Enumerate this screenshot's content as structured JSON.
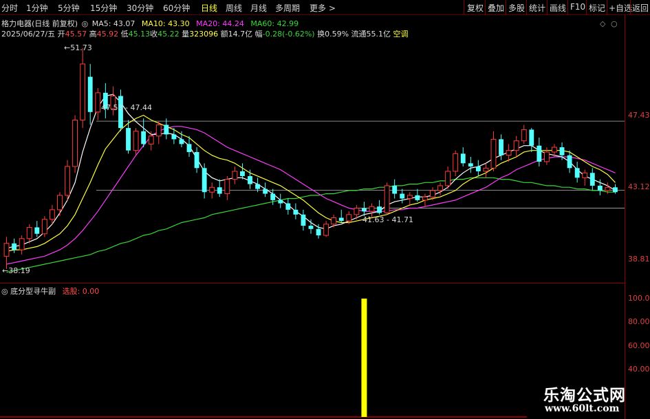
{
  "toolbar": {
    "timeframes": [
      {
        "label": "分时",
        "active": false
      },
      {
        "label": "1分钟",
        "active": false
      },
      {
        "label": "5分钟",
        "active": false
      },
      {
        "label": "15分钟",
        "active": false
      },
      {
        "label": "30分钟",
        "active": false
      },
      {
        "label": "60分钟",
        "active": false
      },
      {
        "label": "日线",
        "active": true
      },
      {
        "label": "周线",
        "active": false
      },
      {
        "label": "月线",
        "active": false
      },
      {
        "label": "多周期",
        "active": false
      },
      {
        "label": "更多 >",
        "active": false
      }
    ],
    "right_buttons": [
      "复权",
      "叠加",
      "多股",
      "统计",
      "画线",
      "F10",
      "标记",
      "+自选",
      "返回"
    ]
  },
  "header": {
    "stock_title": "格力电器(日线 前复权)",
    "ma5": "MA5: 43.07",
    "ma10": "MA10: 43.30",
    "ma20": "MA20: 44.24",
    "ma60": "MA60: 42.99",
    "icons": [
      "◇",
      "○"
    ]
  },
  "quote": {
    "date": "2025/06/27/五",
    "open_label": "开",
    "open": "45.57",
    "high_label": "高",
    "high": "45.92",
    "low_label": "低",
    "low": "45.13",
    "close_label": "收",
    "close": "45.22",
    "vol_label": "量",
    "vol": "323096",
    "amt_label": "额",
    "amt": "14.7亿",
    "chg_label": "幅",
    "chg": "-0.28(-0.62%)",
    "turn_label": "换",
    "turn": "0.59%",
    "float_label": "流通",
    "float": "55.1亿",
    "status": "空调"
  },
  "annotations": {
    "peak": "51.73",
    "low": "38.19",
    "range1": "47.53 - 47.44",
    "range2": "41.63 - 41.71"
  },
  "price_axis": [
    "47.43",
    "43.12",
    "38.81"
  ],
  "indicator": {
    "name": "底分型寻牛副",
    "series_label": "选股: 0.00",
    "axis": [
      "100.0",
      "80.00",
      "60.00",
      "40.00"
    ]
  },
  "watermark": {
    "name": "乐淘公式网",
    "url": "www.60lt.com"
  },
  "chart_data": {
    "type": "candlestick",
    "price_range": [
      37.9,
      52.5
    ],
    "levels": [
      47.43,
      43.12,
      42.0
    ],
    "candles": [
      [
        39.0,
        40.2,
        38.2,
        39.8
      ],
      [
        39.8,
        40.1,
        39.2,
        39.4
      ],
      [
        39.4,
        40.3,
        39.1,
        40.1
      ],
      [
        40.1,
        41.0,
        39.8,
        40.8
      ],
      [
        40.8,
        41.2,
        40.2,
        40.4
      ],
      [
        40.4,
        41.5,
        40.2,
        41.3
      ],
      [
        41.3,
        42.2,
        41.0,
        41.9
      ],
      [
        41.9,
        43.0,
        41.5,
        42.8
      ],
      [
        42.8,
        45.0,
        42.5,
        44.6
      ],
      [
        44.6,
        47.8,
        44.2,
        47.5
      ],
      [
        47.5,
        52.0,
        47.0,
        51.0
      ],
      [
        50.2,
        51.0,
        47.2,
        48.0
      ],
      [
        48.0,
        49.5,
        47.5,
        49.2
      ],
      [
        49.2,
        49.8,
        47.6,
        48.2
      ],
      [
        48.2,
        49.6,
        47.8,
        49.0
      ],
      [
        49.0,
        49.4,
        46.8,
        47.0
      ],
      [
        47.0,
        47.5,
        45.4,
        45.6
      ],
      [
        45.6,
        47.0,
        45.3,
        46.8
      ],
      [
        46.8,
        47.6,
        45.8,
        46.0
      ],
      [
        46.0,
        46.8,
        45.6,
        46.5
      ],
      [
        46.5,
        47.4,
        46.0,
        47.2
      ],
      [
        47.2,
        47.6,
        46.3,
        46.6
      ],
      [
        46.6,
        47.0,
        46.0,
        46.3
      ],
      [
        46.3,
        46.8,
        45.8,
        46.0
      ],
      [
        46.0,
        46.5,
        45.2,
        45.5
      ],
      [
        45.5,
        45.8,
        44.2,
        44.5
      ],
      [
        44.5,
        44.8,
        42.6,
        43.0
      ],
      [
        43.0,
        43.6,
        42.6,
        43.3
      ],
      [
        43.3,
        43.8,
        42.7,
        42.9
      ],
      [
        42.9,
        44.0,
        42.5,
        43.8
      ],
      [
        43.8,
        44.6,
        43.5,
        44.3
      ],
      [
        44.3,
        44.8,
        43.8,
        44.0
      ],
      [
        44.0,
        44.4,
        43.2,
        43.5
      ],
      [
        43.5,
        43.9,
        43.0,
        43.2
      ],
      [
        43.2,
        43.6,
        42.7,
        42.9
      ],
      [
        42.9,
        43.2,
        42.2,
        42.5
      ],
      [
        42.5,
        42.9,
        42.0,
        42.3
      ],
      [
        42.3,
        42.6,
        41.6,
        41.9
      ],
      [
        41.9,
        42.3,
        41.3,
        41.6
      ],
      [
        41.6,
        41.9,
        40.6,
        40.9
      ],
      [
        40.9,
        41.3,
        40.4,
        40.7
      ],
      [
        40.7,
        41.0,
        40.1,
        40.3
      ],
      [
        40.3,
        41.2,
        40.2,
        41.0
      ],
      [
        41.0,
        41.6,
        40.8,
        41.4
      ],
      [
        41.4,
        41.9,
        41.1,
        41.2
      ],
      [
        41.2,
        41.8,
        41.0,
        41.6
      ],
      [
        41.6,
        42.2,
        41.3,
        42.0
      ],
      [
        42.0,
        42.4,
        41.5,
        41.8
      ],
      [
        41.8,
        42.3,
        41.4,
        42.1
      ],
      [
        42.1,
        42.5,
        41.6,
        41.7
      ],
      [
        41.7,
        43.6,
        41.6,
        43.4
      ],
      [
        43.4,
        43.8,
        42.6,
        42.9
      ],
      [
        42.9,
        43.2,
        42.3,
        42.6
      ],
      [
        42.6,
        43.0,
        42.2,
        42.8
      ],
      [
        42.8,
        43.2,
        42.4,
        42.5
      ],
      [
        42.5,
        42.9,
        42.1,
        42.7
      ],
      [
        42.7,
        43.3,
        42.5,
        43.1
      ],
      [
        43.1,
        43.6,
        42.8,
        43.4
      ],
      [
        43.4,
        44.6,
        43.2,
        44.3
      ],
      [
        44.3,
        45.6,
        44.0,
        45.4
      ],
      [
        45.4,
        45.8,
        44.6,
        44.8
      ],
      [
        44.8,
        45.2,
        44.2,
        44.6
      ],
      [
        44.6,
        45.0,
        44.0,
        44.3
      ],
      [
        44.3,
        44.8,
        43.9,
        44.5
      ],
      [
        44.5,
        46.8,
        44.3,
        46.3
      ],
      [
        46.3,
        46.6,
        45.0,
        45.3
      ],
      [
        45.3,
        46.0,
        44.9,
        45.6
      ],
      [
        45.6,
        46.5,
        45.2,
        46.2
      ],
      [
        46.2,
        47.2,
        46.0,
        46.9
      ],
      [
        46.9,
        47.0,
        45.5,
        45.9
      ],
      [
        45.9,
        46.4,
        44.6,
        44.9
      ],
      [
        44.9,
        45.8,
        44.7,
        45.5
      ],
      [
        45.5,
        46.0,
        45.2,
        45.8
      ],
      [
        45.8,
        46.1,
        45.0,
        45.3
      ],
      [
        45.3,
        45.6,
        44.2,
        44.5
      ],
      [
        44.5,
        44.9,
        43.6,
        43.9
      ],
      [
        43.9,
        44.4,
        43.4,
        44.2
      ],
      [
        44.2,
        44.5,
        43.1,
        43.4
      ],
      [
        43.4,
        43.8,
        42.8,
        43.1
      ],
      [
        43.1,
        43.6,
        42.9,
        43.3
      ],
      [
        43.3,
        43.5,
        42.9,
        43.0
      ]
    ],
    "ma5": [
      39.5,
      39.6,
      39.7,
      39.9,
      40.1,
      40.5,
      41.0,
      41.7,
      42.5,
      43.6,
      45.5,
      47.0,
      48.3,
      49.0,
      49.1,
      48.6,
      47.9,
      47.4,
      47.0,
      46.6,
      46.6,
      46.7,
      46.6,
      46.3,
      45.9,
      45.1,
      44.3,
      43.9,
      43.7,
      43.8,
      43.9,
      43.9,
      43.7,
      43.5,
      43.2,
      42.9,
      42.5,
      42.2,
      41.8,
      41.5,
      41.1,
      40.8,
      40.7,
      40.9,
      41.0,
      41.2,
      41.4,
      41.6,
      41.7,
      41.8,
      42.2,
      42.4,
      42.5,
      42.6,
      42.7,
      42.7,
      42.8,
      43.0,
      43.3,
      43.8,
      44.2,
      44.5,
      44.6,
      44.8,
      45.1,
      45.3,
      45.5,
      45.7,
      45.9,
      45.9,
      45.6,
      45.4,
      45.3,
      45.2,
      44.9,
      44.4,
      44.0,
      43.8,
      43.6,
      43.4,
      43.1
    ],
    "ma10": [
      39.3,
      39.4,
      39.4,
      39.5,
      39.6,
      39.8,
      40.1,
      40.4,
      40.9,
      41.6,
      42.6,
      43.6,
      44.7,
      45.7,
      46.3,
      46.9,
      47.3,
      47.6,
      47.8,
      47.5,
      47.3,
      47.1,
      46.9,
      46.6,
      46.4,
      46.0,
      45.6,
      45.3,
      45.1,
      45.0,
      44.8,
      44.5,
      44.2,
      44.0,
      43.8,
      43.6,
      43.4,
      43.1,
      42.8,
      42.5,
      42.1,
      41.7,
      41.4,
      41.2,
      41.1,
      41.1,
      41.2,
      41.3,
      41.4,
      41.5,
      41.6,
      41.8,
      42.0,
      42.2,
      42.3,
      42.5,
      42.6,
      42.7,
      42.9,
      43.1,
      43.5,
      43.8,
      44.0,
      44.2,
      44.5,
      44.8,
      45.0,
      45.2,
      45.5,
      45.6,
      45.6,
      45.6,
      45.6,
      45.6,
      45.5,
      45.2,
      44.9,
      44.6,
      44.4,
      44.1,
      43.6
    ],
    "ma20": [
      38.5,
      38.6,
      38.7,
      38.8,
      38.9,
      39.0,
      39.2,
      39.4,
      39.7,
      40.1,
      40.6,
      41.2,
      41.8,
      42.5,
      43.2,
      43.9,
      44.6,
      45.3,
      45.9,
      46.5,
      46.8,
      47.0,
      47.1,
      47.1,
      47.0,
      46.9,
      46.7,
      46.4,
      46.1,
      45.8,
      45.6,
      45.4,
      45.2,
      45.0,
      44.8,
      44.6,
      44.4,
      44.1,
      43.8,
      43.5,
      43.2,
      42.9,
      42.6,
      42.4,
      42.2,
      42.0,
      41.9,
      41.8,
      41.8,
      41.8,
      41.8,
      41.9,
      41.9,
      42.0,
      42.0,
      42.1,
      42.2,
      42.3,
      42.4,
      42.5,
      42.7,
      42.9,
      43.1,
      43.3,
      43.6,
      43.9,
      44.1,
      44.4,
      44.6,
      44.8,
      45.0,
      45.1,
      45.2,
      45.2,
      45.2,
      45.1,
      45.0,
      44.8,
      44.6,
      44.4,
      44.2
    ],
    "ma60": [
      38.0,
      38.1,
      38.2,
      38.3,
      38.4,
      38.5,
      38.6,
      38.7,
      38.8,
      38.9,
      39.0,
      39.1,
      39.3,
      39.4,
      39.6,
      39.8,
      39.9,
      40.1,
      40.3,
      40.4,
      40.6,
      40.7,
      40.9,
      41.1,
      41.2,
      41.3,
      41.4,
      41.6,
      41.7,
      41.8,
      41.9,
      42.0,
      42.1,
      42.2,
      42.3,
      42.4,
      42.5,
      42.6,
      42.6,
      42.7,
      42.8,
      42.8,
      42.9,
      42.9,
      43.0,
      43.1,
      43.1,
      43.2,
      43.2,
      43.3,
      43.3,
      43.4,
      43.4,
      43.5,
      43.5,
      43.6,
      43.6,
      43.7,
      43.7,
      43.8,
      43.8,
      43.9,
      43.9,
      43.9,
      43.9,
      43.8,
      43.8,
      43.7,
      43.6,
      43.6,
      43.5,
      43.4,
      43.4,
      43.3,
      43.3,
      43.2,
      43.2,
      43.1,
      43.1,
      43.0,
      43.0
    ],
    "indicator_range": [
      0,
      100
    ],
    "signal": {
      "index": 47,
      "value": 100
    }
  },
  "colors": {
    "up": "#ff3c3c",
    "down": "#54ffff",
    "ma5": "#ffffff",
    "ma10": "#ffff3c",
    "ma20": "#ff3cff",
    "ma60": "#39d839",
    "signal": "#ffff00",
    "frame": "#8a0000"
  }
}
